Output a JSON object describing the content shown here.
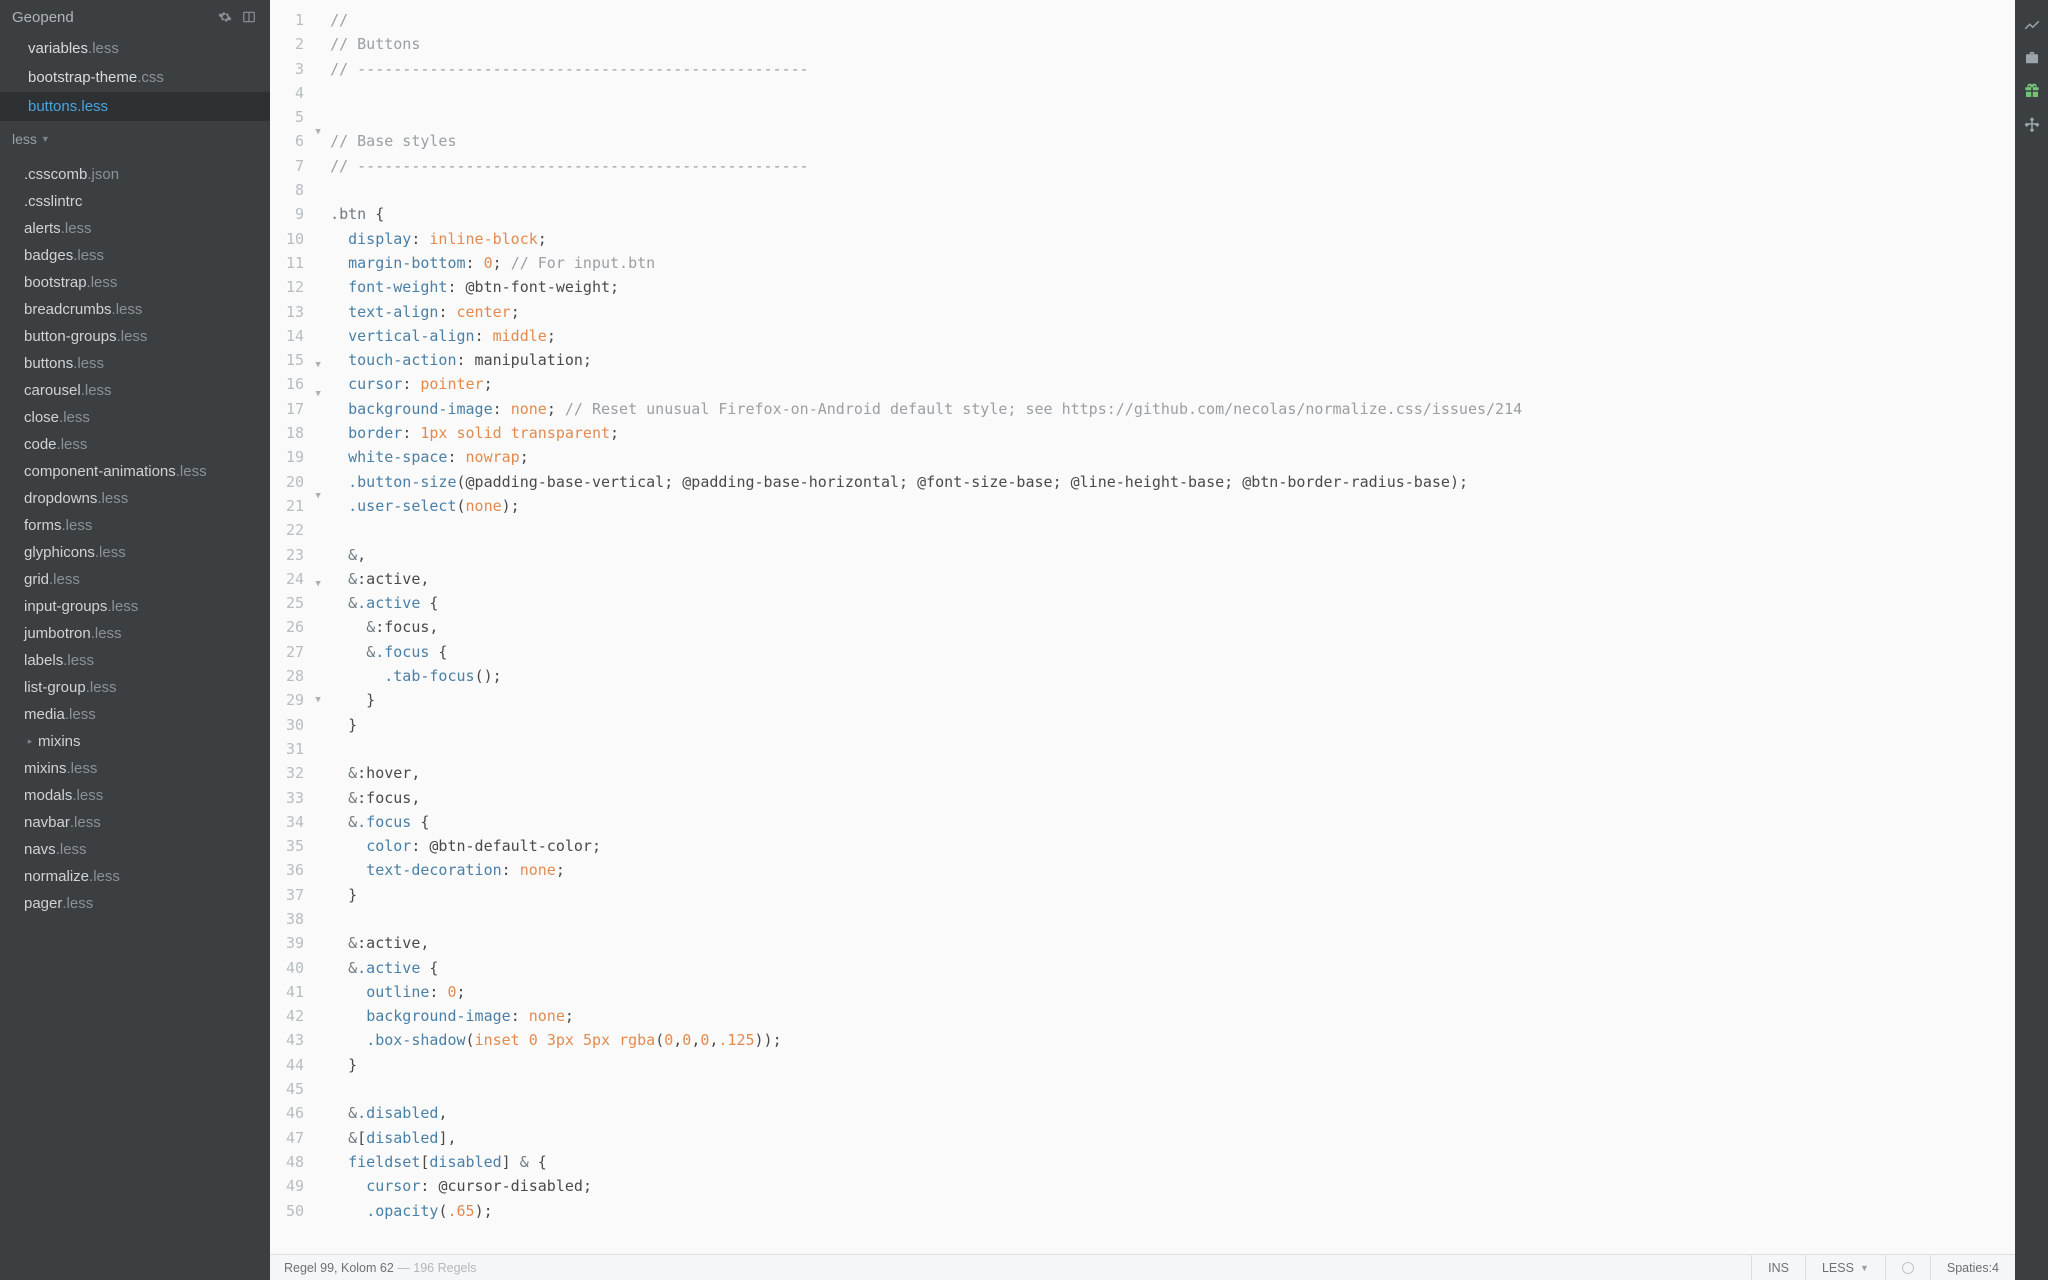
{
  "sidebar": {
    "section_open_title": "Geopend",
    "open_files": [
      {
        "name": "variables",
        "ext": ".less",
        "active": false
      },
      {
        "name": "bootstrap-theme",
        "ext": ".css",
        "active": false
      },
      {
        "name": "buttons",
        "ext": ".less",
        "active": true
      }
    ],
    "folder_label": "less",
    "tree": [
      {
        "name": ".csscomb",
        "ext": ".json"
      },
      {
        "name": ".csslintrc",
        "ext": ""
      },
      {
        "name": "alerts",
        "ext": ".less"
      },
      {
        "name": "badges",
        "ext": ".less"
      },
      {
        "name": "bootstrap",
        "ext": ".less"
      },
      {
        "name": "breadcrumbs",
        "ext": ".less"
      },
      {
        "name": "button-groups",
        "ext": ".less"
      },
      {
        "name": "buttons",
        "ext": ".less"
      },
      {
        "name": "carousel",
        "ext": ".less"
      },
      {
        "name": "close",
        "ext": ".less"
      },
      {
        "name": "code",
        "ext": ".less"
      },
      {
        "name": "component-animations",
        "ext": ".less"
      },
      {
        "name": "dropdowns",
        "ext": ".less"
      },
      {
        "name": "forms",
        "ext": ".less"
      },
      {
        "name": "glyphicons",
        "ext": ".less"
      },
      {
        "name": "grid",
        "ext": ".less"
      },
      {
        "name": "input-groups",
        "ext": ".less"
      },
      {
        "name": "jumbotron",
        "ext": ".less"
      },
      {
        "name": "labels",
        "ext": ".less"
      },
      {
        "name": "list-group",
        "ext": ".less"
      },
      {
        "name": "media",
        "ext": ".less"
      },
      {
        "name": "mixins",
        "ext": "",
        "folder": true
      },
      {
        "name": "mixins",
        "ext": ".less"
      },
      {
        "name": "modals",
        "ext": ".less"
      },
      {
        "name": "navbar",
        "ext": ".less"
      },
      {
        "name": "navs",
        "ext": ".less"
      },
      {
        "name": "normalize",
        "ext": ".less"
      },
      {
        "name": "pager",
        "ext": ".less"
      }
    ]
  },
  "editor": {
    "first_line": 1,
    "fold_lines": [
      9,
      25,
      27,
      34,
      40,
      48
    ],
    "comment_rule": "// --------------------------------------------------",
    "lines": [
      {
        "n": 1,
        "html": "<span class='cm'>//</span>"
      },
      {
        "n": 2,
        "html": "<span class='cm'>// Buttons</span>"
      },
      {
        "n": 3,
        "html": "<span class='cm'>// --------------------------------------------------</span>"
      },
      {
        "n": 4,
        "html": ""
      },
      {
        "n": 5,
        "html": ""
      },
      {
        "n": 6,
        "html": "<span class='cm'>// Base styles</span>"
      },
      {
        "n": 7,
        "html": "<span class='cm'>// --------------------------------------------------</span>"
      },
      {
        "n": 8,
        "html": ""
      },
      {
        "n": 9,
        "html": "<span class='sel'>.btn</span> {"
      },
      {
        "n": 10,
        "html": "  <span class='prop'>display</span>: <span class='val'>inline-block</span>;"
      },
      {
        "n": 11,
        "html": "  <span class='prop'>margin-bottom</span>: <span class='val'>0</span>; <span class='cm'>// For input.btn</span>"
      },
      {
        "n": 12,
        "html": "  <span class='prop'>font-weight</span>: <span class='var'>@btn-font-weight</span>;"
      },
      {
        "n": 13,
        "html": "  <span class='prop'>text-align</span>: <span class='val'>center</span>;"
      },
      {
        "n": 14,
        "html": "  <span class='prop'>vertical-align</span>: <span class='val'>middle</span>;"
      },
      {
        "n": 15,
        "html": "  <span class='prop'>touch-action</span>: manipulation;"
      },
      {
        "n": 16,
        "html": "  <span class='prop'>cursor</span>: <span class='val'>pointer</span>;"
      },
      {
        "n": 17,
        "html": "  <span class='prop'>background-image</span>: <span class='val'>none</span>; <span class='cm'>// Reset unusual Firefox-on-Android default style; see https://github.com/necolas/normalize.css/issues/214</span>"
      },
      {
        "n": 18,
        "html": "  <span class='prop'>border</span>: <span class='val'>1px</span> <span class='val'>solid</span> <span class='val'>transparent</span>;"
      },
      {
        "n": 19,
        "html": "  <span class='prop'>white-space</span>: <span class='val'>nowrap</span>;"
      },
      {
        "n": 20,
        "html": "  <span class='mix'>.button-size</span>(<span class='var'>@padding-base-vertical</span>; <span class='var'>@padding-base-horizontal</span>; <span class='var'>@font-size-base</span>; <span class='var'>@line-height-base</span>; <span class='var'>@btn-border-radius-base</span>);"
      },
      {
        "n": 21,
        "html": "  <span class='mix'>.user-select</span>(<span class='val'>none</span>);"
      },
      {
        "n": 22,
        "html": ""
      },
      {
        "n": 23,
        "html": "  <span class='sel'>&amp;</span>,"
      },
      {
        "n": 24,
        "html": "  <span class='sel'>&amp;</span>:active,"
      },
      {
        "n": 25,
        "html": "  <span class='sel'>&amp;</span><span class='mix'>.active</span> {"
      },
      {
        "n": 26,
        "html": "    <span class='sel'>&amp;</span>:focus,"
      },
      {
        "n": 27,
        "html": "    <span class='sel'>&amp;</span><span class='mix'>.focus</span> {"
      },
      {
        "n": 28,
        "html": "      <span class='mix'>.tab-focus</span>();"
      },
      {
        "n": 29,
        "html": "    }"
      },
      {
        "n": 30,
        "html": "  }"
      },
      {
        "n": 31,
        "html": ""
      },
      {
        "n": 32,
        "html": "  <span class='sel'>&amp;</span>:hover,"
      },
      {
        "n": 33,
        "html": "  <span class='sel'>&amp;</span>:focus,"
      },
      {
        "n": 34,
        "html": "  <span class='sel'>&amp;</span><span class='mix'>.focus</span> {"
      },
      {
        "n": 35,
        "html": "    <span class='prop'>color</span>: <span class='var'>@btn-default-color</span>;"
      },
      {
        "n": 36,
        "html": "    <span class='prop'>text-decoration</span>: <span class='val'>none</span>;"
      },
      {
        "n": 37,
        "html": "  }"
      },
      {
        "n": 38,
        "html": ""
      },
      {
        "n": 39,
        "html": "  <span class='sel'>&amp;</span>:active,"
      },
      {
        "n": 40,
        "html": "  <span class='sel'>&amp;</span><span class='mix'>.active</span> {"
      },
      {
        "n": 41,
        "html": "    <span class='prop'>outline</span>: <span class='val'>0</span>;"
      },
      {
        "n": 42,
        "html": "    <span class='prop'>background-image</span>: <span class='val'>none</span>;"
      },
      {
        "n": 43,
        "html": "    <span class='mix'>.box-shadow</span>(<span class='val'>inset</span> <span class='val'>0</span> <span class='val'>3px</span> <span class='val'>5px</span> <span class='val'>rgba</span>(<span class='val'>0</span>,<span class='val'>0</span>,<span class='val'>0</span>,<span class='val'>.125</span>));"
      },
      {
        "n": 44,
        "html": "  }"
      },
      {
        "n": 45,
        "html": ""
      },
      {
        "n": 46,
        "html": "  <span class='sel'>&amp;</span><span class='mix'>.disabled</span>,"
      },
      {
        "n": 47,
        "html": "  <span class='sel'>&amp;</span>[<span class='attr'>disabled</span>],"
      },
      {
        "n": 48,
        "html": "  <span class='attr'>fieldset</span>[<span class='attr'>disabled</span>] <span class='sel'>&amp;</span> {"
      },
      {
        "n": 49,
        "html": "    <span class='prop'>cursor</span>: <span class='var'>@cursor-disabled</span>;"
      },
      {
        "n": 50,
        "html": "    <span class='mix'>.opacity</span>(<span class='val'>.65</span>);"
      }
    ]
  },
  "statusbar": {
    "cursor_prefix": "Regel ",
    "cursor_line": "99",
    "cursor_mid": ", Kolom ",
    "cursor_col": "62",
    "total_sep": " — ",
    "total_lines": "196 Regels",
    "ins": "INS",
    "lang": "LESS",
    "spaces_label": "Spaties: ",
    "spaces_value": "4"
  },
  "rail_icons": [
    "chart-line-icon",
    "briefcase-icon",
    "gift-icon",
    "plugin-icon"
  ]
}
